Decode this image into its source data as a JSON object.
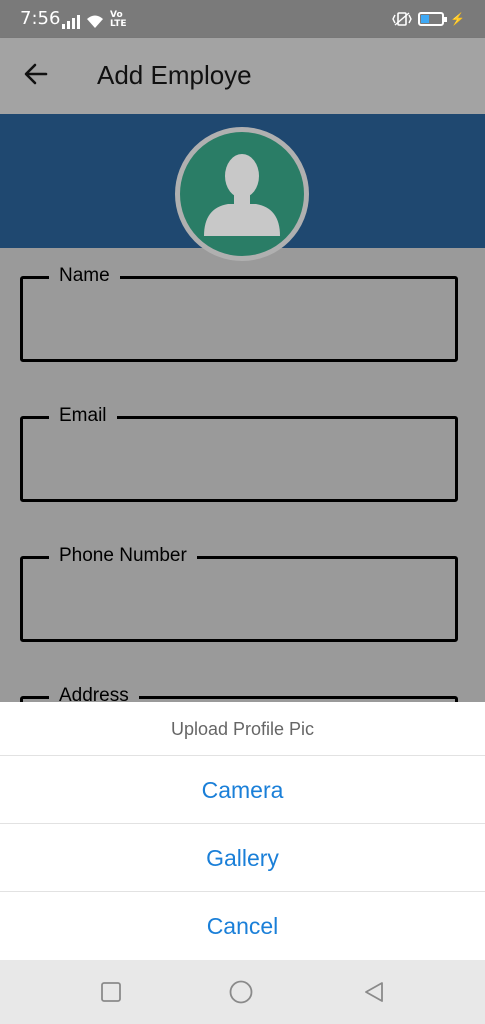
{
  "status_bar": {
    "time": "7:56",
    "network_label": "Vo\nLTE",
    "battery_level": 0.35,
    "accent": "#3fa9f5"
  },
  "app_bar": {
    "title": "Add Employe",
    "back_icon": "arrow-left-icon"
  },
  "header": {
    "banner_color": "#1f4870",
    "avatar_color": "#2a7d66",
    "avatar_icon": "person-silhouette-icon"
  },
  "form": {
    "fields": [
      {
        "label": "Name",
        "value": ""
      },
      {
        "label": "Email",
        "value": ""
      },
      {
        "label": "Phone Number",
        "value": ""
      },
      {
        "label": "Address",
        "value": ""
      }
    ]
  },
  "action_sheet": {
    "title": "Upload Profile Pic",
    "options": [
      "Camera",
      "Gallery",
      "Cancel"
    ],
    "option_color": "#1a7fd8"
  },
  "nav_bar": {
    "icons": [
      "square-recents-icon",
      "circle-home-icon",
      "triangle-back-icon"
    ]
  }
}
